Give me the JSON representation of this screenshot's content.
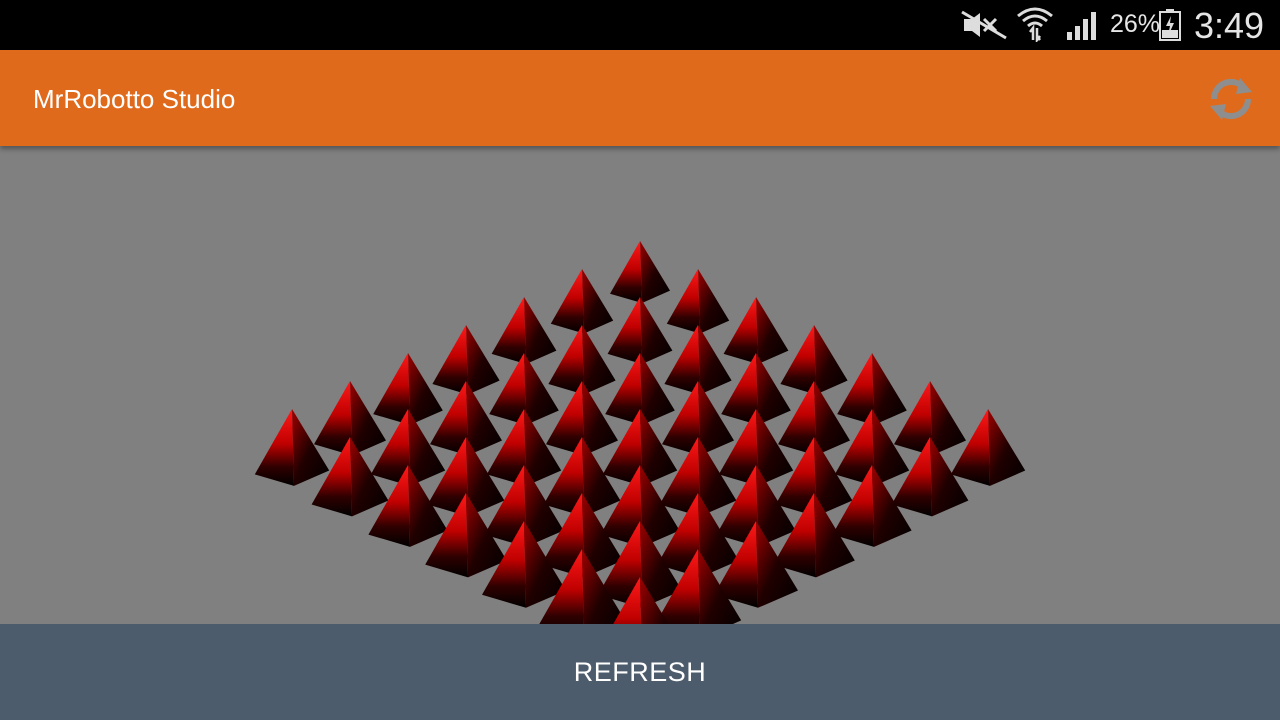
{
  "status_bar": {
    "icons": [
      "mute-icon",
      "wifi-icon",
      "signal-icon",
      "battery-icon"
    ],
    "battery_percent": "26%",
    "time": "3:49"
  },
  "app_bar": {
    "title": "MrRobotto Studio",
    "action_icon": "sync-refresh-icon",
    "color": "#e06a1b"
  },
  "scene": {
    "object": "red-pyramid",
    "background_color": "#808080",
    "object_color": "#d40000"
  },
  "bottom_button": {
    "label": "REFRESH",
    "color": "#4d5c6c"
  }
}
